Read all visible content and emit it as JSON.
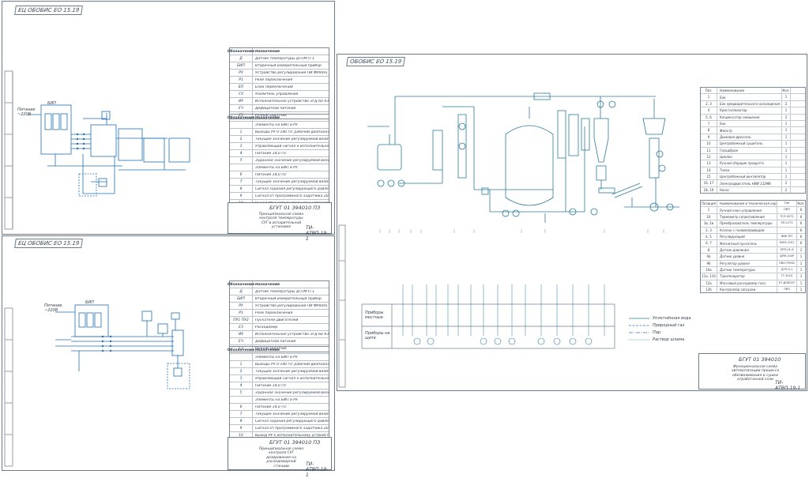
{
  "sheets": {
    "top_left_label": "ЕЦ ОБОБИС ЕО 15.19",
    "bottom_left_label": "ЕЦ ОБОБИС ЕО 15.19",
    "right_label": "ОБОБИС ЕО 15.19"
  },
  "left_top": {
    "power_label": "Питание ~220В",
    "bsk_label": "БИП",
    "legend1": [
      {
        "code": "Обозначение",
        "name": "Назначение"
      },
      {
        "code": "Д",
        "name": "Датчик температуры ДТПМ-П-1"
      },
      {
        "code": "БИП",
        "name": "Вторичный измерительный прибор"
      },
      {
        "code": "РУ",
        "name": "Устройство регулирования ПИ ФР0091"
      },
      {
        "code": "Р1",
        "name": "Реле переключения"
      },
      {
        "code": "БП",
        "name": "Блок переключений"
      },
      {
        "code": "СУ",
        "name": "Усилитель управления"
      },
      {
        "code": "ИУ",
        "name": "Исполнительное устройство ЭГД-60 АЗОЛ, ЕТЗО, ПЭ6-2, ВС.Ж"
      },
      {
        "code": "ЕЧ",
        "name": "Дефицитное питание"
      },
      {
        "code": "ЕЗ",
        "name": "Ручной задатчик"
      }
    ],
    "legend2": [
      {
        "code": "Обозначение",
        "name": "Назначение"
      },
      {
        "code": "",
        "name": "Элементы на БИП и РУ"
      },
      {
        "code": "1",
        "name": "Выходы РУ 0-140 г/с рабочий диапазон 20-100 г/с"
      },
      {
        "code": "2",
        "name": "Текущее значение регулируемой величины 20-100 г/с"
      },
      {
        "code": "3",
        "name": "Управляющий сигнал к исполнительному реле РУ"
      },
      {
        "code": "4",
        "name": "Питание 14,0 г/с"
      },
      {
        "code": "5",
        "name": "Заданное значение регулируемой величины 20-100 г/с"
      },
      {
        "code": "",
        "name": "Элементы на БИП и РУ"
      },
      {
        "code": "6",
        "name": "Питание 14,0 г/с"
      },
      {
        "code": "7",
        "name": "Текущее значение регулируемой величины 20-100 г/с"
      },
      {
        "code": "8",
        "name": "Сигнал задания регулирующего давления 20-100 г/с"
      },
      {
        "code": "9",
        "name": "Сигнал от программного задатчика 20-100 г/с"
      },
      {
        "code": "10",
        "name": "Выход РУ к исполнительному устройству 0-140 г/с"
      }
    ],
    "title_block": {
      "code": "БГУТ 01 394010 ПЗ",
      "title": "Принципиальная схема контроля температуры СУГ в испарительной установке",
      "group": "ТИ-АТВП-19-1"
    }
  },
  "left_bottom": {
    "power_label": "Питание ~220В",
    "bsk_label": "БИП",
    "legend1": [
      {
        "code": "Обозначение",
        "name": "Назначение"
      },
      {
        "code": "Д",
        "name": "Датчик температуры ДТПМ-П-1"
      },
      {
        "code": "БИП",
        "name": "Вторичный измерительный прибор"
      },
      {
        "code": "РУ",
        "name": "Устройство регулирования ПИ ФР0091"
      },
      {
        "code": "Р1",
        "name": "Реле переключения"
      },
      {
        "code": "ПУ1 ПУ2",
        "name": "Пускатели двигателей"
      },
      {
        "code": "ЕЗ",
        "name": "Расходомер"
      },
      {
        "code": "ИУ",
        "name": "Исполнительное устройство ЭГД-60 АЗОЛ, ЕТЗО, ПЭ6-2, ВС.Ж"
      },
      {
        "code": "ЕЧ",
        "name": "Дефицитное питание"
      },
      {
        "code": "ЕЗ",
        "name": "Ручной задатчик"
      }
    ],
    "legend2": [
      {
        "code": "Обозначение",
        "name": "Назначение"
      },
      {
        "code": "",
        "name": "Элементы на БИП и РУ"
      },
      {
        "code": "1",
        "name": "Выходы РУ 0-140 г/с рабочий диапазон 20-100 г/с"
      },
      {
        "code": "2",
        "name": "Текущее значение регулируемой величины 20-100 г/с"
      },
      {
        "code": "3",
        "name": "Управляющий сигнал к исполнительному реле РУ"
      },
      {
        "code": "4",
        "name": "Питание 14,0 г/с"
      },
      {
        "code": "5",
        "name": "Заданное значение регулируемой величины 20-100 г/с"
      },
      {
        "code": "",
        "name": "Элементы на БИП и РУ"
      },
      {
        "code": "6",
        "name": "Питание 14,0 г/с"
      },
      {
        "code": "7",
        "name": "Текущее значение регулируемой величины 20-100 г/с"
      },
      {
        "code": "8",
        "name": "Сигнал задания регулирующего давления 20-100 г/с"
      },
      {
        "code": "9",
        "name": "Сигнал от программного задатчика 20-100 г/с"
      },
      {
        "code": "10",
        "name": "Выход РУ к исполнительному устройству 0-140 г/с"
      }
    ],
    "title_block": {
      "code": "БГУТ 01 394010 ПЗ",
      "title": "Принципиальная схема контроля СУГ дозирования на расходомерной станции",
      "group": "ТИ-АТВП-19-1"
    }
  },
  "right": {
    "spec": [
      {
        "pos": "Поз.",
        "name": "Наименование",
        "qty": "Кол."
      },
      {
        "pos": "1",
        "name": "Бак",
        "qty": "1"
      },
      {
        "pos": "2, 3",
        "name": "Бак предварительного охлаждения",
        "qty": "2"
      },
      {
        "pos": "4",
        "name": "Кристаллизатор",
        "qty": "1"
      },
      {
        "pos": "5, 6",
        "name": "Конденсатор смешения",
        "qty": "2"
      },
      {
        "pos": "7",
        "name": "Бак",
        "qty": "1"
      },
      {
        "pos": "8",
        "name": "Фильтр",
        "qty": "1"
      },
      {
        "pos": "9",
        "name": "Дымовая дроссель",
        "qty": "1"
      },
      {
        "pos": "10",
        "name": "Центробежный сушитель",
        "qty": "1"
      },
      {
        "pos": "11",
        "name": "Гильдбрюк",
        "qty": "1"
      },
      {
        "pos": "12",
        "name": "Циклон",
        "qty": "1"
      },
      {
        "pos": "13",
        "name": "Ручной сборщик продукта",
        "qty": "1"
      },
      {
        "pos": "14",
        "name": "Топка",
        "qty": "1"
      },
      {
        "pos": "15",
        "name": "Центробежный вентилятор",
        "qty": "1"
      },
      {
        "pos": "16, 17",
        "name": "Электродвигатель НИИ 132М8",
        "qty": "2"
      },
      {
        "pos": "18, 19",
        "name": "Насос",
        "qty": "2"
      }
    ],
    "instruments": [
      {
        "pos": "Позиция",
        "name": "Наименование и техническая характеристика",
        "type": "Тип",
        "qty": "Кол."
      },
      {
        "pos": "1",
        "name": "Ручной ключ управления",
        "type": "ПКП",
        "qty": "6"
      },
      {
        "pos": "1б",
        "name": "Термометр сопротивления",
        "type": "ТСП-5071",
        "qty": "6"
      },
      {
        "pos": "1в, 1в",
        "name": "Преобразователь температуры",
        "type": "ЭП-1271",
        "qty": "6"
      },
      {
        "pos": "2, 3",
        "name": "Клапан с пневмоприводом",
        "type": "",
        "qty": "6"
      },
      {
        "pos": "4, 5",
        "name": "Регулирующий",
        "type": "ВИК-ПП",
        "qty": "6"
      },
      {
        "pos": "6, 7",
        "name": "Магнитный пускатель",
        "type": "ПМЛ-1501",
        "qty": "6"
      },
      {
        "pos": "8",
        "name": "Датчик давления",
        "type": "ЭПП-01-А",
        "qty": "2"
      },
      {
        "pos": "9а",
        "name": "Датчик уровня",
        "type": "ДУМ-100Р",
        "qty": "1"
      },
      {
        "pos": "9б",
        "name": "Регулятор уровня",
        "type": "ПВЛ-79901",
        "qty": "1"
      },
      {
        "pos": "10а",
        "name": "Датчик температуры",
        "type": "ДТП-0-1",
        "qty": "1"
      },
      {
        "pos": "11а, 11б",
        "name": "Тахогенератор",
        "type": "ТГ-4010",
        "qty": "1"
      },
      {
        "pos": "12а",
        "name": "Массовый расходомер газа",
        "type": "ЕТ-ДОБ007",
        "qty": "1"
      },
      {
        "pos": "12б",
        "name": "Контроллер загрузки",
        "type": "ПКП",
        "qty": "1"
      }
    ],
    "signal_rows": {
      "row1": "Приборы местные",
      "row2": "Приборы на щите"
    },
    "flow_legend": [
      "Уплотнённая вода",
      "Природный газ",
      "Пар",
      "Раствор шлама"
    ],
    "title_block": {
      "code": "БГУТ 01 394010",
      "title": "Функциональная схема автоматизации процесса обезвоживания и сушки отработанной соли",
      "group": "ТИ-АТВП-19-1"
    }
  }
}
